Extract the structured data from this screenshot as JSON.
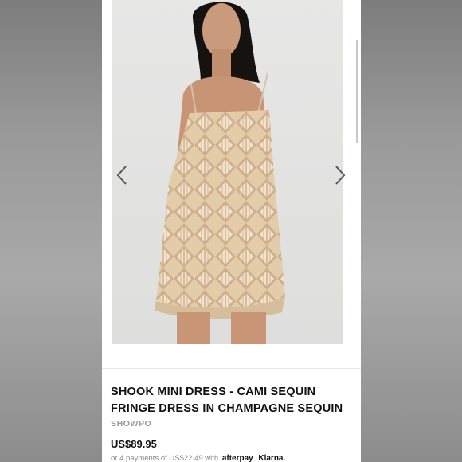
{
  "product": {
    "title_line1": "SHOOK MINI DRESS - CAMI SEQUIN",
    "title_line2": "FRINGE DRESS IN CHAMPAGNE SEQUIN",
    "brand": "SHOWPO",
    "price": "US$89.95",
    "installments_text": "or 4 payments of US$22.49 with",
    "afterpay_label": "afterpay",
    "klarna_label": "Klarna."
  },
  "icons": {
    "prev": "chevron-left-icon",
    "next": "chevron-right-icon"
  },
  "colors": {
    "sequin": "#d9bc96",
    "background": "#ffffff",
    "text": "#111111",
    "muted": "#9a9a9a"
  }
}
